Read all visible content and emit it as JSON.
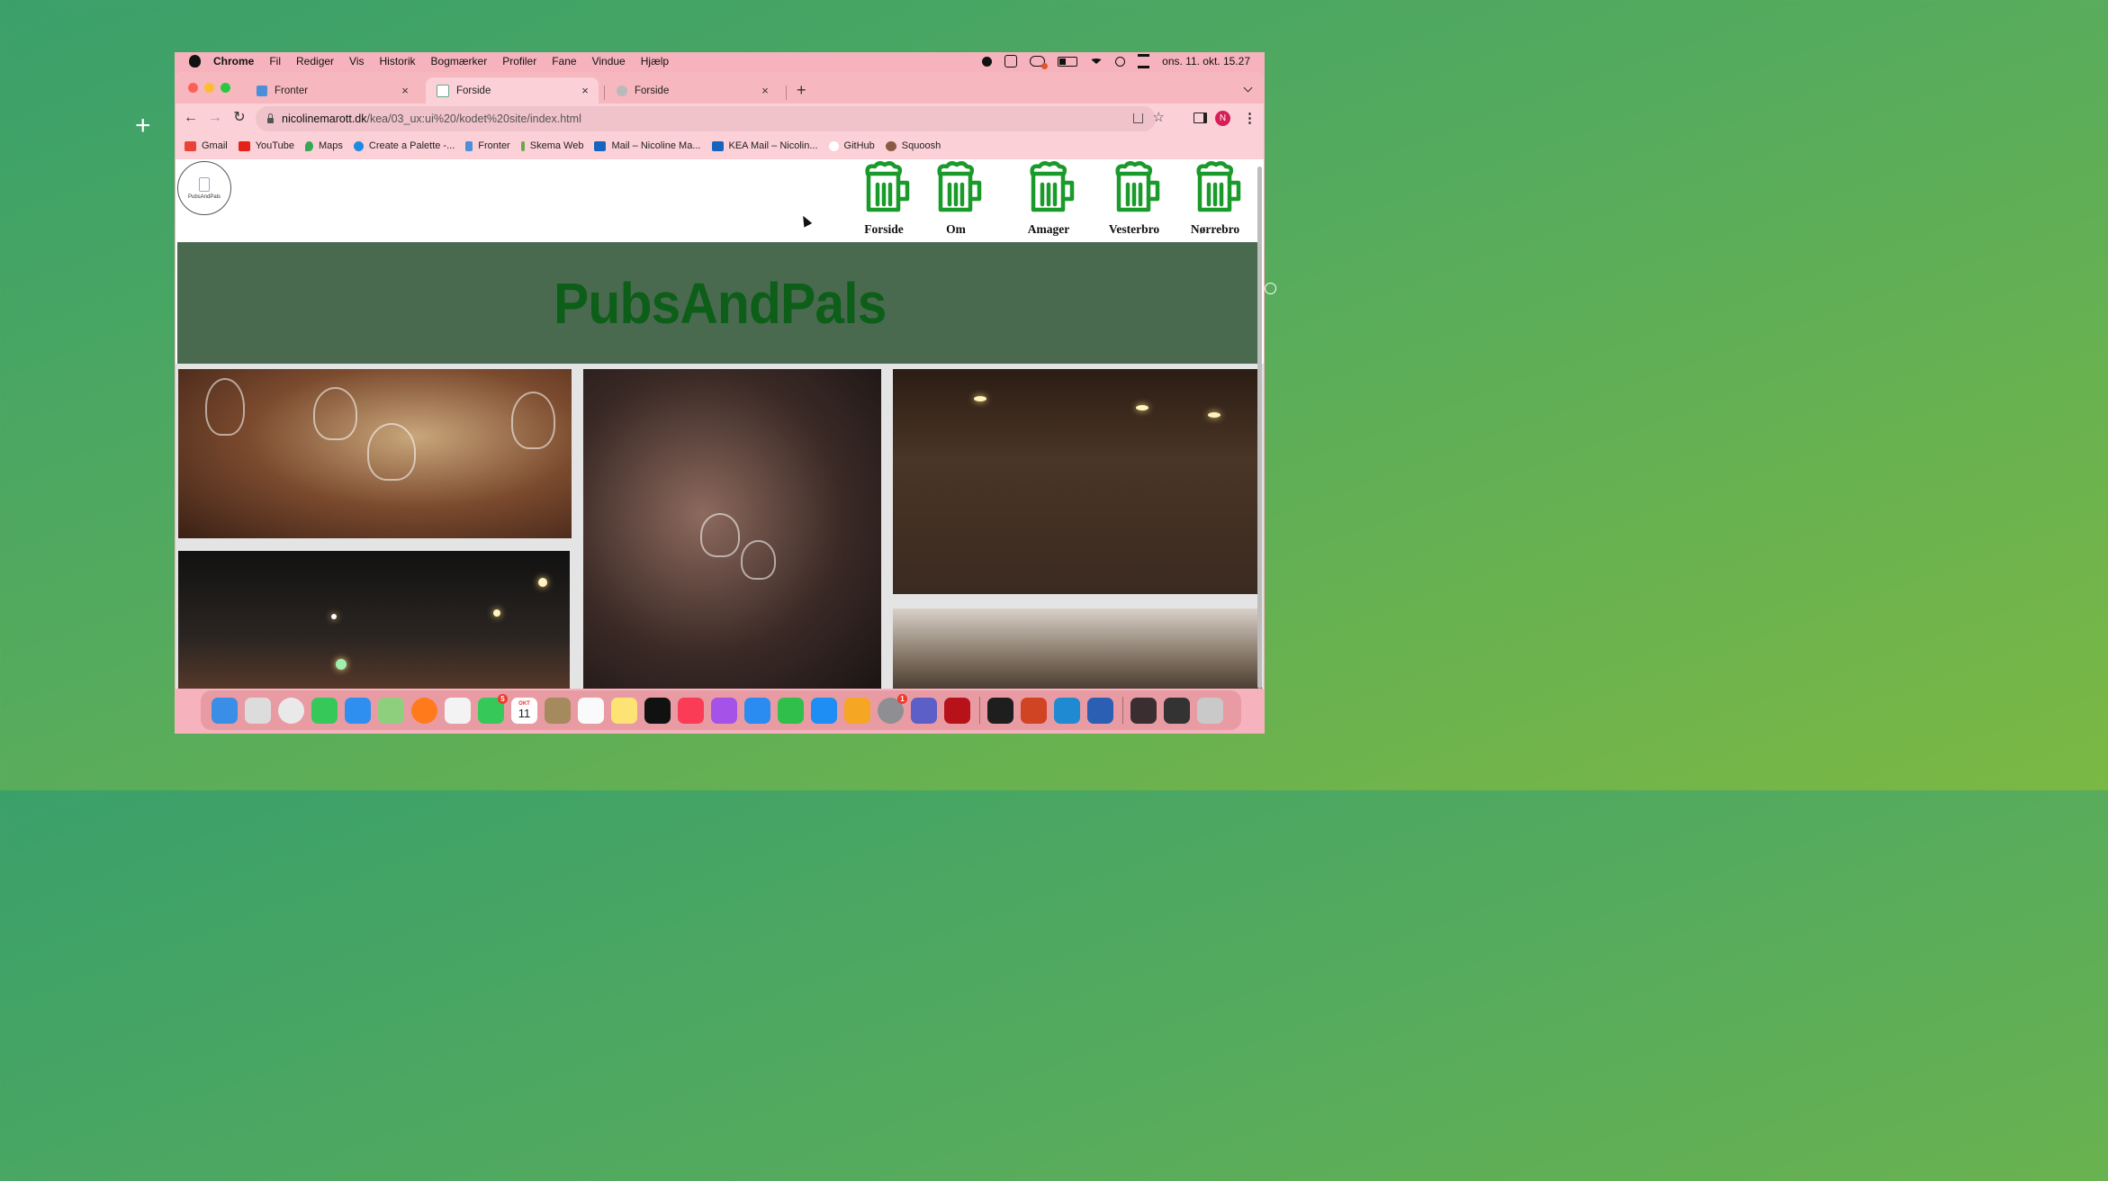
{
  "menubar": {
    "app": "Chrome",
    "items": [
      "Fil",
      "Rediger",
      "Vis",
      "Historik",
      "Bogmærker",
      "Profiler",
      "Fane",
      "Vindue",
      "Hjælp"
    ],
    "clock": "ons. 11. okt. 15.27"
  },
  "tabs": [
    {
      "title": "Fronter",
      "active": false
    },
    {
      "title": "Forside",
      "active": true
    },
    {
      "title": "Forside",
      "active": false
    }
  ],
  "address": {
    "host": "nicolinemarott.dk",
    "path": "/kea/03_ux:ui%20/kodet%20site/index.html"
  },
  "profile_initial": "N",
  "bookmarks": [
    {
      "label": "Gmail",
      "icon": "gmail-icon",
      "color": "#ea4335"
    },
    {
      "label": "YouTube",
      "icon": "youtube-icon",
      "color": "#e62117"
    },
    {
      "label": "Maps",
      "icon": "maps-icon",
      "color": "#34a853"
    },
    {
      "label": "Create a Palette -...",
      "icon": "coolors-icon",
      "color": "#1e88e5"
    },
    {
      "label": "Fronter",
      "icon": "fronter-icon",
      "color": "#4a8fd8"
    },
    {
      "label": "Skema Web",
      "icon": "skema-icon",
      "color": "#6aa84f"
    },
    {
      "label": "Mail – Nicoline Ma...",
      "icon": "outlook-icon",
      "color": "#1565c0"
    },
    {
      "label": "KEA Mail – Nicolin...",
      "icon": "outlook-icon",
      "color": "#1565c0"
    },
    {
      "label": "GitHub",
      "icon": "github-icon",
      "color": "#ffffff"
    },
    {
      "label": "Squoosh",
      "icon": "squoosh-icon",
      "color": "#8a5a44"
    }
  ],
  "page": {
    "logo_text": "PubsAndPals",
    "nav": [
      "Forside",
      "Om",
      "Amager",
      "Vesterbro",
      "Nørrebro"
    ],
    "hero_title": "PubsAndPals",
    "colors": {
      "hero_bg": "#4a6a50",
      "hero_text": "#0d5e18",
      "beer_icon": "#1a9a2a"
    }
  },
  "dock": {
    "badges": {
      "facetime": "5",
      "calendar_month": "OKT",
      "calendar_day": "11",
      "settings": "1"
    }
  }
}
